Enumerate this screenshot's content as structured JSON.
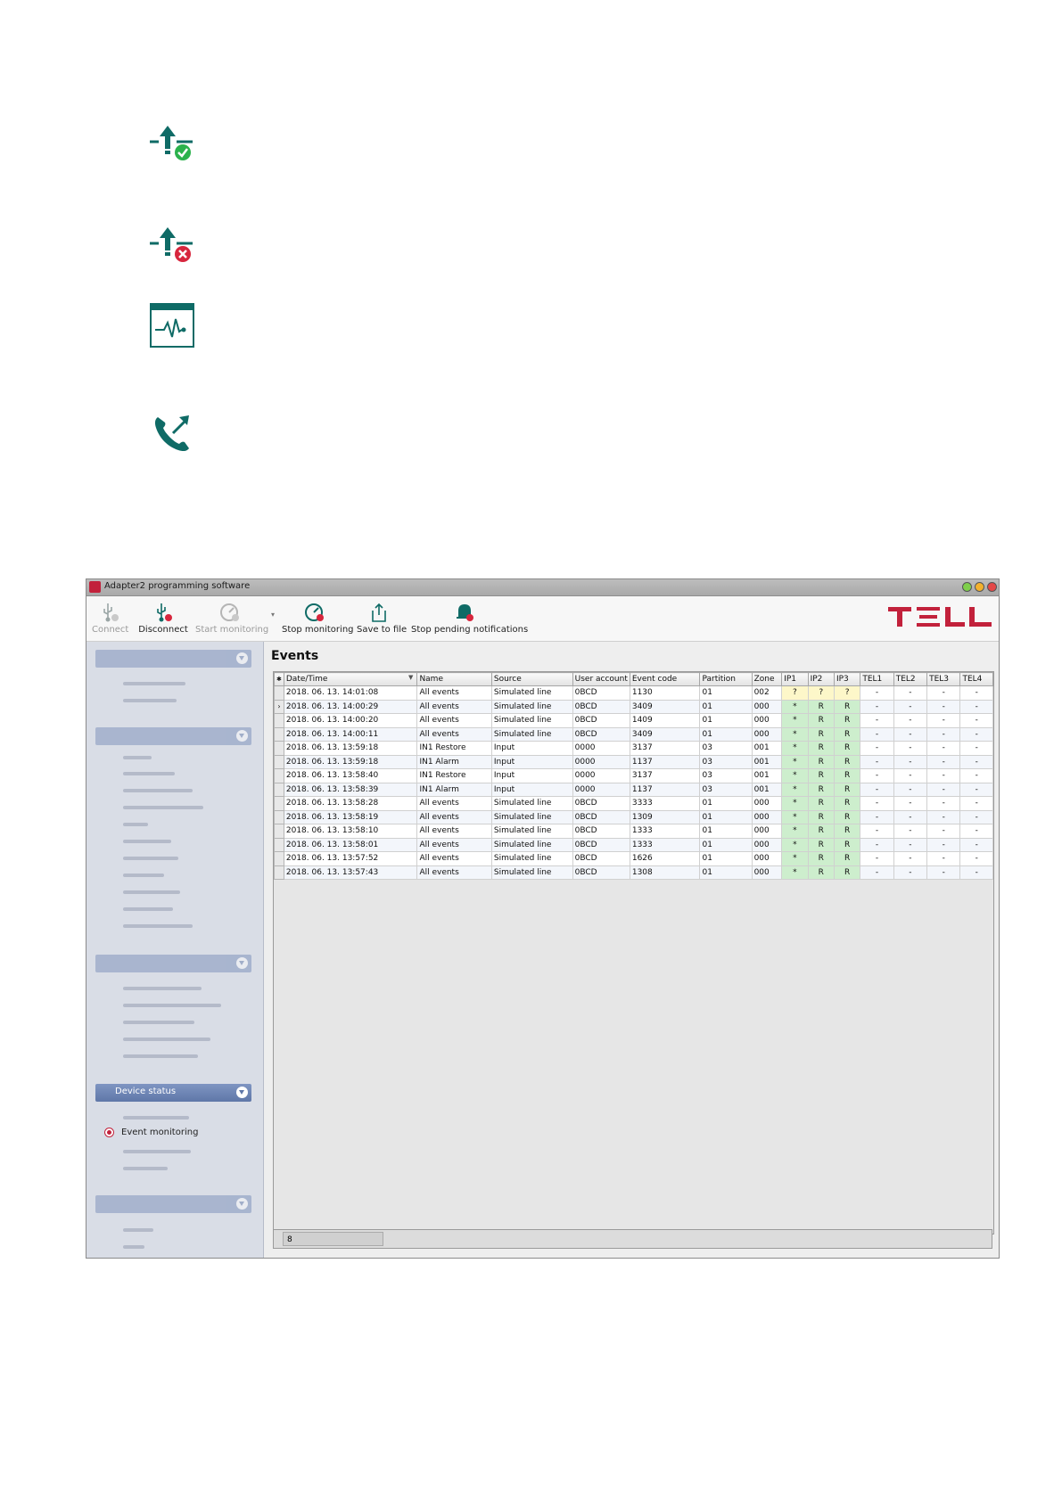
{
  "window": {
    "title": "Adapter2 programming software"
  },
  "toolbar": {
    "connect": "Connect",
    "disconnect": "Disconnect",
    "start_monitoring": "Start monitoring",
    "stop_monitoring": "Stop monitoring",
    "save_to_file": "Save to file",
    "stop_pending": "Stop pending notifications"
  },
  "sidebar": {
    "device_status": "Device status",
    "event_monitoring": "Event monitoring"
  },
  "content": {
    "heading": "Events"
  },
  "table": {
    "columns": [
      "Date/Time",
      "Name",
      "Source",
      "User account",
      "Event code",
      "Partition",
      "Zone",
      "IP1",
      "IP2",
      "IP3",
      "TEL1",
      "TEL2",
      "TEL3",
      "TEL4"
    ],
    "rows": [
      [
        "2018. 06. 13. 14:01:08",
        "All events",
        "Simulated line",
        "0BCD",
        "1130",
        "01",
        "002",
        "?",
        "?",
        "?",
        "-",
        "-",
        "-",
        "-"
      ],
      [
        "2018. 06. 13. 14:00:29",
        "All events",
        "Simulated line",
        "0BCD",
        "3409",
        "01",
        "000",
        "*",
        "R",
        "R",
        "-",
        "-",
        "-",
        "-"
      ],
      [
        "2018. 06. 13. 14:00:20",
        "All events",
        "Simulated line",
        "0BCD",
        "1409",
        "01",
        "000",
        "*",
        "R",
        "R",
        "-",
        "-",
        "-",
        "-"
      ],
      [
        "2018. 06. 13. 14:00:11",
        "All events",
        "Simulated line",
        "0BCD",
        "3409",
        "01",
        "000",
        "*",
        "R",
        "R",
        "-",
        "-",
        "-",
        "-"
      ],
      [
        "2018. 06. 13. 13:59:18",
        "IN1 Restore",
        "Input",
        "0000",
        "3137",
        "03",
        "001",
        "*",
        "R",
        "R",
        "-",
        "-",
        "-",
        "-"
      ],
      [
        "2018. 06. 13. 13:59:18",
        "IN1 Alarm",
        "Input",
        "0000",
        "1137",
        "03",
        "001",
        "*",
        "R",
        "R",
        "-",
        "-",
        "-",
        "-"
      ],
      [
        "2018. 06. 13. 13:58:40",
        "IN1 Restore",
        "Input",
        "0000",
        "3137",
        "03",
        "001",
        "*",
        "R",
        "R",
        "-",
        "-",
        "-",
        "-"
      ],
      [
        "2018. 06. 13. 13:58:39",
        "IN1 Alarm",
        "Input",
        "0000",
        "1137",
        "03",
        "001",
        "*",
        "R",
        "R",
        "-",
        "-",
        "-",
        "-"
      ],
      [
        "2018. 06. 13. 13:58:28",
        "All events",
        "Simulated line",
        "0BCD",
        "3333",
        "01",
        "000",
        "*",
        "R",
        "R",
        "-",
        "-",
        "-",
        "-"
      ],
      [
        "2018. 06. 13. 13:58:19",
        "All events",
        "Simulated line",
        "0BCD",
        "1309",
        "01",
        "000",
        "*",
        "R",
        "R",
        "-",
        "-",
        "-",
        "-"
      ],
      [
        "2018. 06. 13. 13:58:10",
        "All events",
        "Simulated line",
        "0BCD",
        "1333",
        "01",
        "000",
        "*",
        "R",
        "R",
        "-",
        "-",
        "-",
        "-"
      ],
      [
        "2018. 06. 13. 13:58:01",
        "All events",
        "Simulated line",
        "0BCD",
        "1333",
        "01",
        "000",
        "*",
        "R",
        "R",
        "-",
        "-",
        "-",
        "-"
      ],
      [
        "2018. 06. 13. 13:57:52",
        "All events",
        "Simulated line",
        "0BCD",
        "1626",
        "01",
        "000",
        "*",
        "R",
        "R",
        "-",
        "-",
        "-",
        "-"
      ],
      [
        "2018. 06. 13. 13:57:43",
        "All events",
        "Simulated line",
        "0BCD",
        "1308",
        "01",
        "000",
        "*",
        "R",
        "R",
        "-",
        "-",
        "-",
        "-"
      ]
    ]
  },
  "statusbar": {
    "count": "8"
  }
}
